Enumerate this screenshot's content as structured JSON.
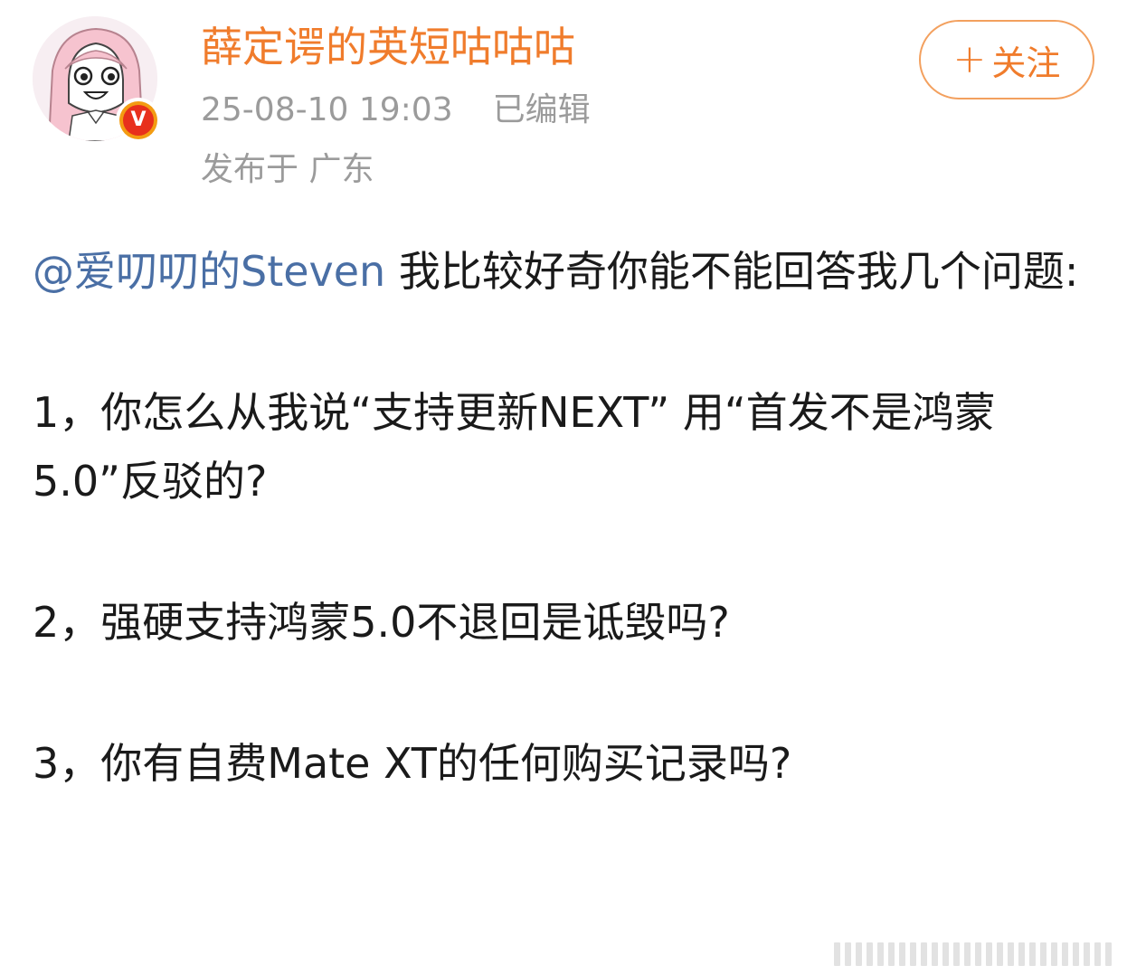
{
  "post": {
    "author": {
      "name": "薛定谔的英短咕咕咕",
      "verified": true,
      "verified_badge_letter": "V"
    },
    "meta": {
      "timestamp": "25-08-10 19:03",
      "edited_label": "已编辑",
      "location": "发布于 广东"
    },
    "follow_button": {
      "icon": "plus-icon",
      "label": "关注"
    },
    "content": {
      "mention": "@爱叨叨的Steven",
      "intro": " 我比较好奇你能不能回答我几个问题:",
      "q1": "1，你怎么从我说“支持更新NEXT” 用“首发不是鸿蒙5.0”反驳的?",
      "q2": "2，强硬支持鸿蒙5.0不退回是诋毁吗?",
      "q3": "3，你有自费Mate XT的任何购买记录吗?"
    }
  },
  "colors": {
    "username": "#f07c2c",
    "mention": "#4a6fa5",
    "meta": "#9b9b9b",
    "follow_border": "#f3a05e",
    "badge": "#e8301c"
  }
}
